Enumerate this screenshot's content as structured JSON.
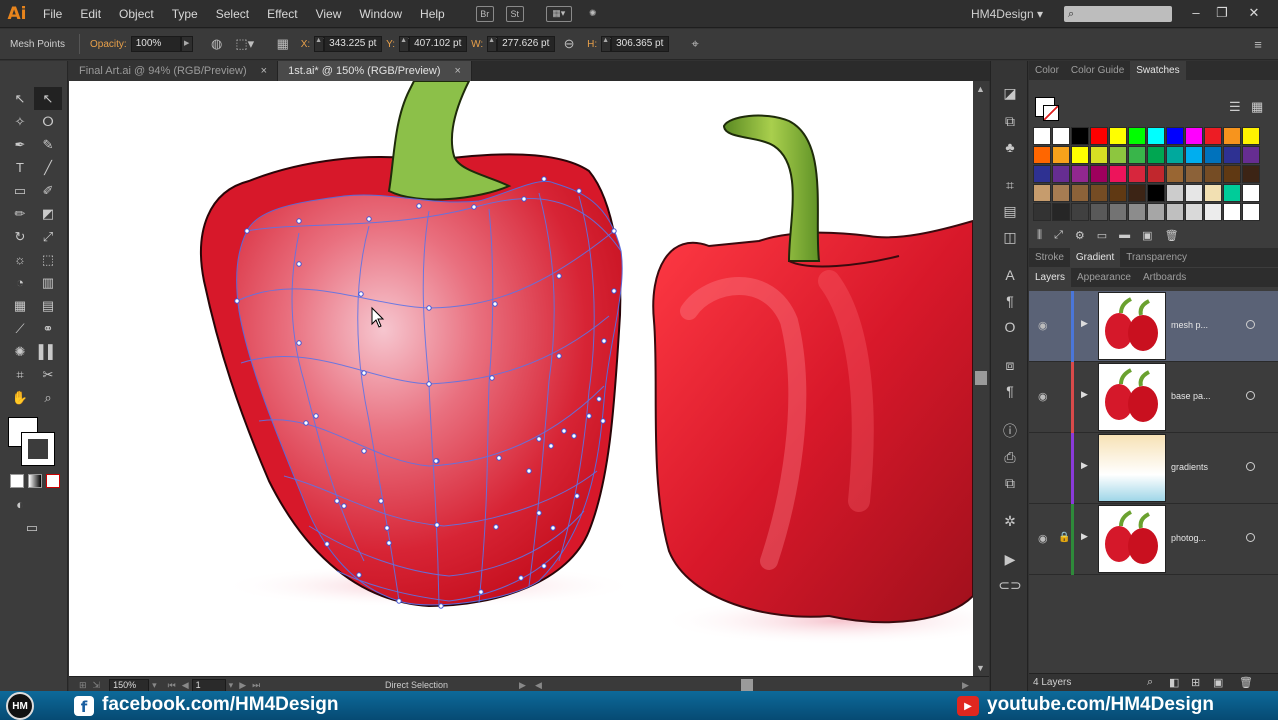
{
  "app": {
    "logo": "Ai",
    "menus": [
      "File",
      "Edit",
      "Object",
      "Type",
      "Select",
      "Effect",
      "View",
      "Window",
      "Help"
    ],
    "workspace": "HM4Design",
    "bridge_icons": [
      "Br",
      "St"
    ]
  },
  "control_bar": {
    "selection_label": "Mesh Points",
    "opacity_label": "Opacity:",
    "opacity_value": "100%",
    "x_label": "X:",
    "x_value": "343.225 pt",
    "y_label": "Y:",
    "y_value": "407.102 pt",
    "w_label": "W:",
    "w_value": "277.626 pt",
    "h_label": "H:",
    "h_value": "306.365 pt"
  },
  "documents": [
    {
      "title": "Final Art.ai @ 94% (RGB/Preview)",
      "close": "×",
      "active": false
    },
    {
      "title": "1st.ai* @ 150% (RGB/Preview)",
      "close": "×",
      "active": true
    }
  ],
  "status_bar": {
    "zoom": "150%",
    "artboard": "1",
    "current_tool": "Direct Selection"
  },
  "panels": {
    "color_tabs": [
      "Color",
      "Color Guide",
      "Swatches"
    ],
    "mid_tabs": [
      "Stroke",
      "Gradient",
      "Transparency"
    ],
    "layer_tabs": [
      "Layers",
      "Appearance",
      "Artboards"
    ],
    "swatches": [
      "#ffffff",
      "#ffffff",
      "#000000",
      "#ff0000",
      "#ffff00",
      "#00ff00",
      "#00ffff",
      "#0000ff",
      "#ff00ff",
      "#ed1c24",
      "#f7941d",
      "#fff200",
      "#ff6600",
      "#f7a21b",
      "#ffff00",
      "#d7df23",
      "#8dc63f",
      "#39b54a",
      "#00a651",
      "#00a99d",
      "#00aeef",
      "#0072bc",
      "#2e3192",
      "#662d91",
      "#2e3192",
      "#662d91",
      "#92278f",
      "#9e005d",
      "#ed145b",
      "#d7263d",
      "#c1272d",
      "#996633",
      "#8c6239",
      "#754c24",
      "#603913",
      "#3c2415",
      "#c69c6d",
      "#a67c52",
      "#8c6239",
      "#754c24",
      "#603913",
      "#3c2415",
      "#000000",
      "#cccccc",
      "#e6e6e6",
      "#f2e0b2",
      "#0c9",
      "#ffffff",
      "#333333",
      "#262626",
      "#404040",
      "#595959",
      "#737373",
      "#8c8c8c",
      "#a6a6a6",
      "#bfbfbf",
      "#d9d9d9",
      "#ececec",
      "#ffffff",
      "#ffffff"
    ],
    "layers": [
      {
        "name": "mesh p...",
        "color": "#4a76d9",
        "selected": true,
        "locked": false,
        "visible": true
      },
      {
        "name": "base pa...",
        "color": "#d94a4a",
        "selected": false,
        "locked": false,
        "visible": true
      },
      {
        "name": "gradients",
        "color": "#8a3ad9",
        "selected": false,
        "locked": false,
        "visible": false
      },
      {
        "name": "photog...",
        "color": "#2e8a3a",
        "selected": false,
        "locked": true,
        "visible": true
      }
    ],
    "layer_count": "4 Layers"
  },
  "social": {
    "logo": "HM",
    "facebook_icon": "f",
    "facebook": "facebook.com/HM4Design",
    "youtube_icon": "▶",
    "youtube": "youtube.com/HM4Design"
  }
}
